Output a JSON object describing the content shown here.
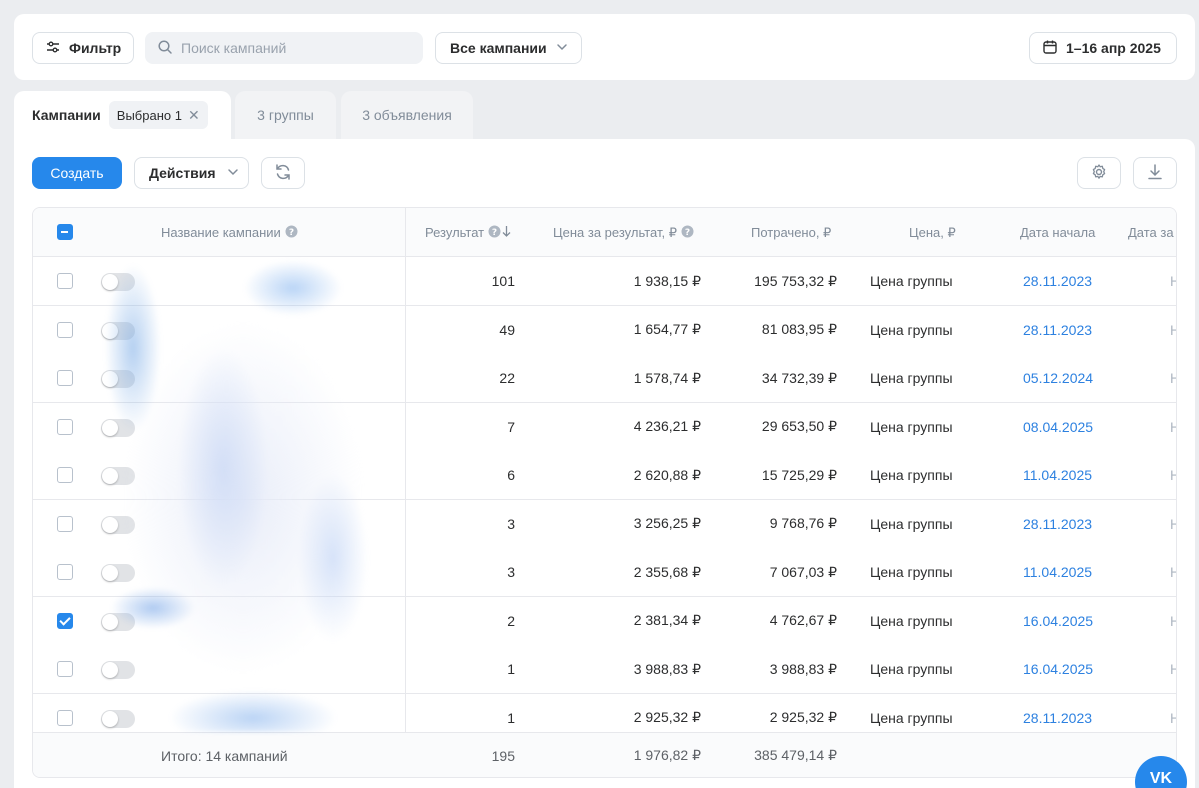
{
  "toolbar": {
    "filter_label": "Фильтр",
    "search_placeholder": "Поиск кампаний",
    "all_campaigns_label": "Все кампании",
    "date_range": "1–16 апр 2025"
  },
  "tabs": {
    "campaigns_label": "Кампании",
    "selected_chip": "Выбрано 1",
    "groups_label": "3 группы",
    "ads_label": "3 объявления"
  },
  "actions": {
    "create_label": "Создать",
    "actions_label": "Действия"
  },
  "table": {
    "headers": {
      "name": "Название кампании",
      "result": "Результат",
      "price_per_result": "Цена за результат, ₽",
      "spent": "Потрачено, ₽",
      "price": "Цена, ₽",
      "start_date": "Дата начала",
      "end_date": "Дата за"
    },
    "rows": [
      {
        "result": "101",
        "price_per_result": "1 938,15 ₽",
        "spent": "195 753,32 ₽",
        "price": "Цена группы",
        "start_date": "28.11.2023",
        "end_date": "Н",
        "checked": false
      },
      {
        "result": "49",
        "price_per_result": "1 654,77 ₽",
        "spent": "81 083,95 ₽",
        "price": "Цена группы",
        "start_date": "28.11.2023",
        "end_date": "Н",
        "checked": false
      },
      {
        "result": "22",
        "price_per_result": "1 578,74 ₽",
        "spent": "34 732,39 ₽",
        "price": "Цена группы",
        "start_date": "05.12.2024",
        "end_date": "Н",
        "checked": false
      },
      {
        "result": "7",
        "price_per_result": "4 236,21 ₽",
        "spent": "29 653,50 ₽",
        "price": "Цена группы",
        "start_date": "08.04.2025",
        "end_date": "Н",
        "checked": false
      },
      {
        "result": "6",
        "price_per_result": "2 620,88 ₽",
        "spent": "15 725,29 ₽",
        "price": "Цена группы",
        "start_date": "11.04.2025",
        "end_date": "Н",
        "checked": false
      },
      {
        "result": "3",
        "price_per_result": "3 256,25 ₽",
        "spent": "9 768,76 ₽",
        "price": "Цена группы",
        "start_date": "28.11.2023",
        "end_date": "Н",
        "checked": false
      },
      {
        "result": "3",
        "price_per_result": "2 355,68 ₽",
        "spent": "7 067,03 ₽",
        "price": "Цена группы",
        "start_date": "11.04.2025",
        "end_date": "Н",
        "checked": false
      },
      {
        "result": "2",
        "price_per_result": "2 381,34 ₽",
        "spent": "4 762,67 ₽",
        "price": "Цена группы",
        "start_date": "16.04.2025",
        "end_date": "Н",
        "checked": true
      },
      {
        "result": "1",
        "price_per_result": "3 988,83 ₽",
        "spent": "3 988,83 ₽",
        "price": "Цена группы",
        "start_date": "16.04.2025",
        "end_date": "Н",
        "checked": false
      },
      {
        "result": "1",
        "price_per_result": "2 925,32 ₽",
        "spent": "2 925,32 ₽",
        "price": "Цена группы",
        "start_date": "28.11.2023",
        "end_date": "Н",
        "checked": false
      }
    ],
    "footer": {
      "total_label": "Итого: 14 кампаний",
      "result": "195",
      "price_per_result": "1 976,82 ₽",
      "spent": "385 479,14 ₽"
    }
  },
  "colors": {
    "accent": "#2688eb",
    "date_link": "#2d81e0",
    "muted": "#818c99"
  },
  "icons": [
    "filter-icon",
    "search-icon",
    "chevron-down-icon",
    "calendar-icon",
    "close-icon",
    "refresh-icon",
    "gear-icon",
    "download-icon",
    "help-icon",
    "sort-down-icon",
    "vk-logo-icon"
  ]
}
